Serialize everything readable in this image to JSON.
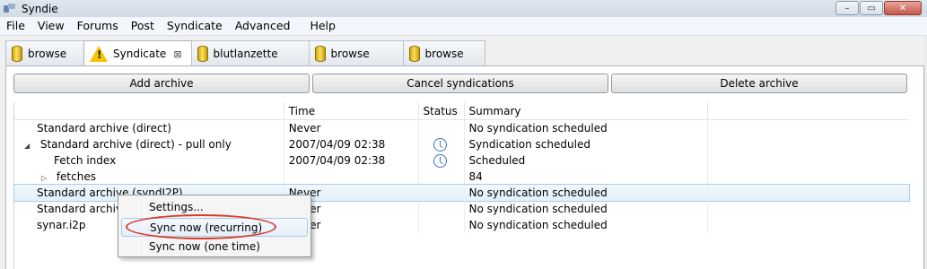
{
  "window": {
    "title": "Syndie",
    "controls": [
      "–",
      "▭",
      "✕"
    ]
  },
  "menu": [
    "File",
    "View",
    "Forums",
    "Post",
    "Syndicate",
    "Advanced",
    "Help"
  ],
  "tabs": [
    {
      "label": "browse",
      "icon": "db-icon",
      "active": false
    },
    {
      "label": "Syndicate",
      "icon": "warning-icon",
      "active": true,
      "close": "⊠"
    },
    {
      "label": "blutlanzette",
      "icon": "db-icon",
      "active": false
    },
    {
      "label": "browse",
      "icon": "db-icon",
      "active": false
    },
    {
      "label": "browse",
      "icon": "db-icon",
      "active": false
    }
  ],
  "buttons": {
    "add": "Add archive",
    "cancel": "Cancel syndications",
    "delete": "Delete archive"
  },
  "table": {
    "headers": [
      "",
      "Time",
      "Status",
      "Summary",
      ""
    ],
    "rows": [
      {
        "name": "Standard archive (direct)",
        "twisty": "",
        "time": "Never",
        "status": "",
        "summary": "No syndication scheduled"
      },
      {
        "name": "Standard archive (direct) - pull only",
        "twisty": "◢",
        "time": "2007/04/09 02:38",
        "status": "clock",
        "summary": "Syndication scheduled"
      },
      {
        "name": "Fetch index",
        "twisty": "",
        "time": "2007/04/09 02:38",
        "status": "clock",
        "summary": "Scheduled"
      },
      {
        "name": "fetches",
        "twisty": "▷",
        "time": "",
        "status": "",
        "summary": "84"
      },
      {
        "name": "Standard archive (syndI2P)",
        "twisty": "",
        "time": "Never",
        "status": "",
        "summary": "No syndication scheduled"
      },
      {
        "name": "Standard archive",
        "twisty": "",
        "time": "Never",
        "status": "",
        "summary": "No syndication scheduled"
      },
      {
        "name": "synar.i2p",
        "twisty": "",
        "time": "Never",
        "status": "",
        "summary": "No syndication scheduled"
      }
    ]
  },
  "context_menu": {
    "items": [
      "Settings...",
      "Sync now (recurring)",
      "Sync now (one time)"
    ],
    "highlighted_index": 1
  },
  "colors": {
    "selection": "#e3f0fa",
    "annotation": "#d83a2a",
    "clock": "#3b73b9"
  }
}
